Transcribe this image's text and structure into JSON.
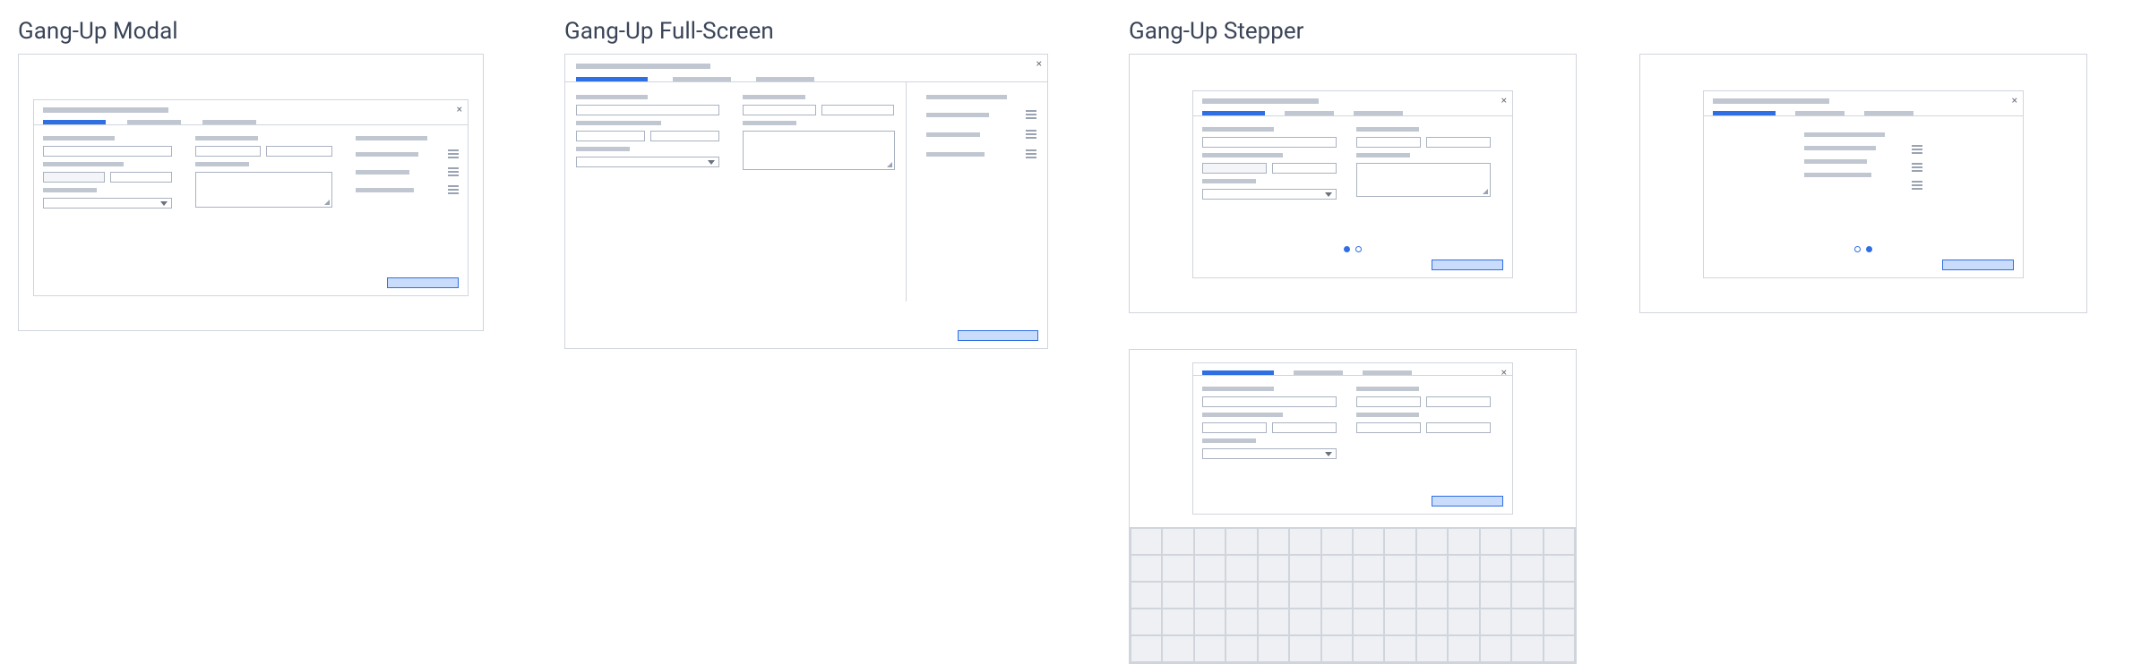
{
  "sections": {
    "modal": {
      "title": "Gang-Up Modal"
    },
    "fullscreen": {
      "title": "Gang-Up Full-Screen"
    },
    "stepper": {
      "title": "Gang-Up Stepper"
    }
  },
  "icons": {
    "close": "×"
  },
  "colors": {
    "accent": "#2f6fe4",
    "accent_fill": "#c9dcfb",
    "grey": "#c0c7d1",
    "light": "#e8ecf2",
    "border": "#d0d5dd",
    "text": "#3a4558"
  },
  "stepper_dots": {
    "card_a": [
      true,
      false
    ],
    "card_b": [
      false,
      true
    ]
  },
  "grid": {
    "cols": 14,
    "rows": 5
  }
}
